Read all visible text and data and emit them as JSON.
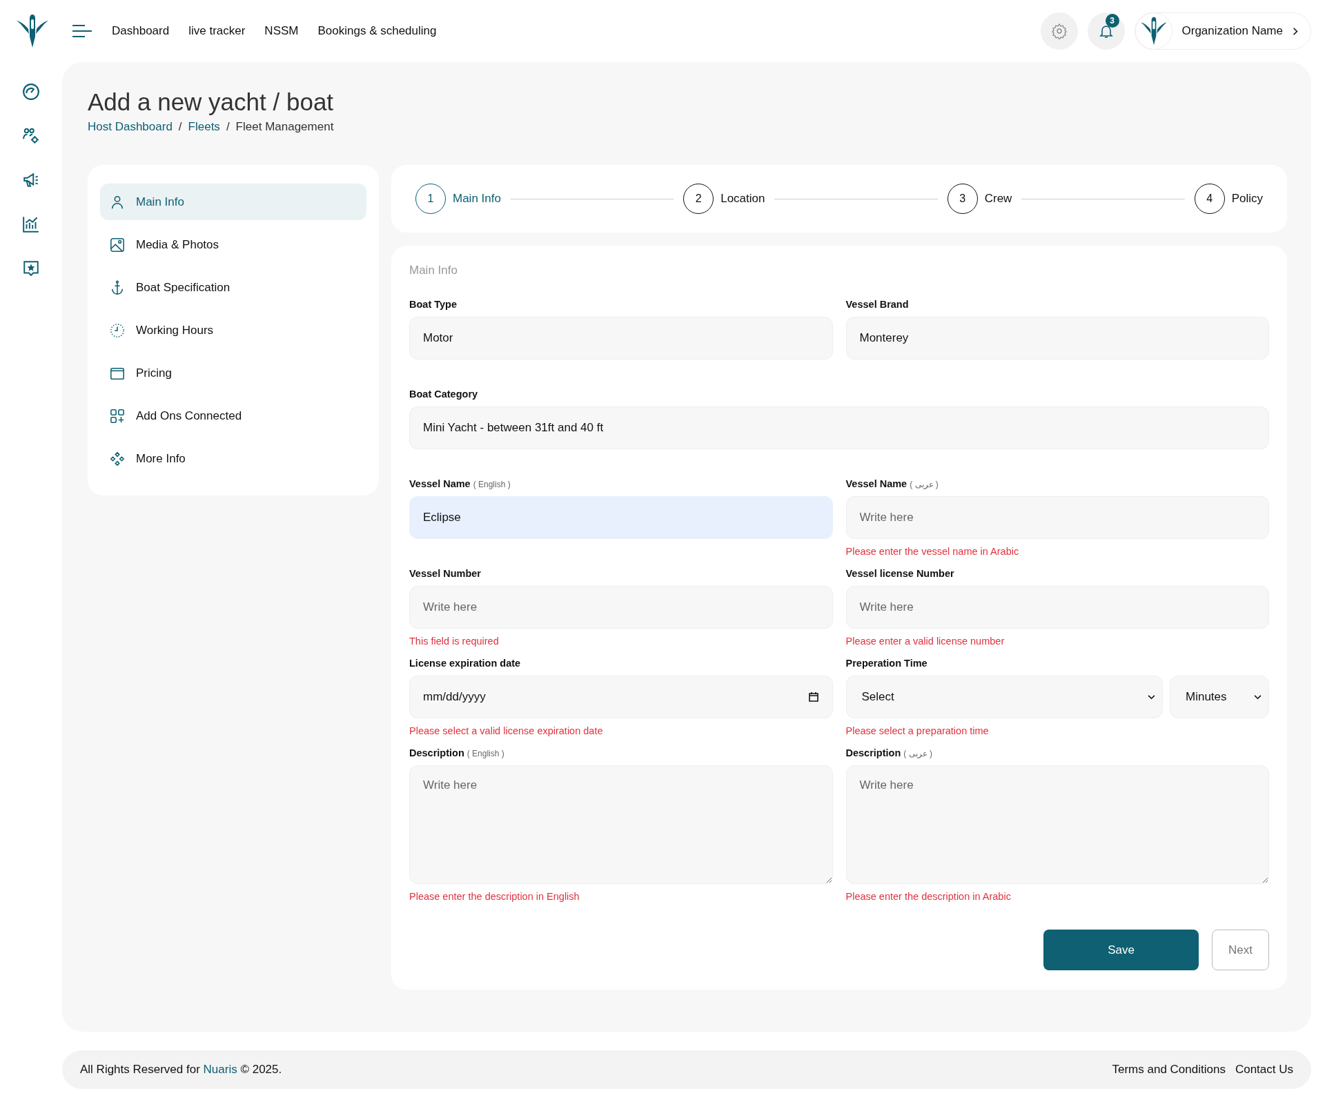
{
  "topbar": {
    "links": [
      {
        "label": "Dashboard"
      },
      {
        "label": "live tracker"
      },
      {
        "label": "NSSM"
      },
      {
        "label": "Bookings & scheduling"
      }
    ],
    "notification_count": "3",
    "organization": "Organization Name"
  },
  "page": {
    "title": "Add a new yacht / boat",
    "breadcrumb": [
      {
        "label": "Host Dashboard",
        "kind": "link"
      },
      {
        "label": "/",
        "kind": "separator"
      },
      {
        "label": "Fleets",
        "kind": "link"
      },
      {
        "label": "/",
        "kind": "separator"
      },
      {
        "label": "Fleet Management",
        "kind": "current"
      }
    ]
  },
  "sections": [
    {
      "label": "Main Info",
      "selected": true
    },
    {
      "label": "Media & Photos",
      "selected": false
    },
    {
      "label": "Boat Specification",
      "selected": false
    },
    {
      "label": "Working Hours",
      "selected": false
    },
    {
      "label": "Pricing",
      "selected": false
    },
    {
      "label": "Add Ons Connected",
      "selected": false
    },
    {
      "label": "More Info",
      "selected": false
    }
  ],
  "steps": [
    {
      "number": "1",
      "label": "Main Info",
      "selected": true
    },
    {
      "number": "2",
      "label": "Location",
      "selected": false
    },
    {
      "number": "3",
      "label": "Crew",
      "selected": false
    },
    {
      "number": "4",
      "label": "Policy",
      "selected": false
    }
  ],
  "form": {
    "heading": "Main Info",
    "fields": [
      {
        "kind": "input",
        "label": "Boat Type",
        "value": "Motor"
      },
      {
        "kind": "input",
        "label": "Vessel Brand",
        "value": "Monterey"
      },
      {
        "kind": "input",
        "label": "Boat Category",
        "value": "Mini Yacht - between 31ft and 40 ft",
        "wide": true
      },
      {
        "kind": "input",
        "label": "Vessel Name",
        "note": "( English )",
        "value": "Eclipse",
        "highlighted": true
      },
      {
        "kind": "input",
        "label": "Vessel Name",
        "note": "( عربى )",
        "placeholder": "Write here",
        "error": "Please enter the vessel name in Arabic"
      },
      {
        "kind": "input",
        "label": "Vessel Number",
        "placeholder": "Write here",
        "error": "This field is required"
      },
      {
        "kind": "input",
        "label": "Vessel license Number",
        "placeholder": "Write here",
        "error": "Please enter a valid license number"
      },
      {
        "kind": "date",
        "label": "License expiration date",
        "placeholder": "mm/dd/yyyy",
        "error": "Please select a valid license expiration date"
      },
      {
        "kind": "select_pair",
        "label": "Preperation Time",
        "value": "Select",
        "unit": "Minutes",
        "error": "Please select a preparation time"
      },
      {
        "kind": "textarea",
        "label": "Description",
        "note": "( English )",
        "placeholder": "Write here",
        "error": "Please enter the description in English"
      },
      {
        "kind": "textarea",
        "label": "Description",
        "note": "( عربى )",
        "placeholder": "Write here",
        "error": "Please enter the description in Arabic"
      }
    ],
    "buttons": [
      {
        "label": "Save",
        "kind": "primary"
      },
      {
        "label": "Next",
        "kind": "secondary"
      }
    ]
  },
  "footer": {
    "prefix": "All Rights Reserved for ",
    "brand": "Nuaris",
    "suffix": " © 2025.",
    "links": [
      {
        "label": "Terms and Conditions"
      },
      {
        "label": "Contact Us"
      }
    ]
  }
}
